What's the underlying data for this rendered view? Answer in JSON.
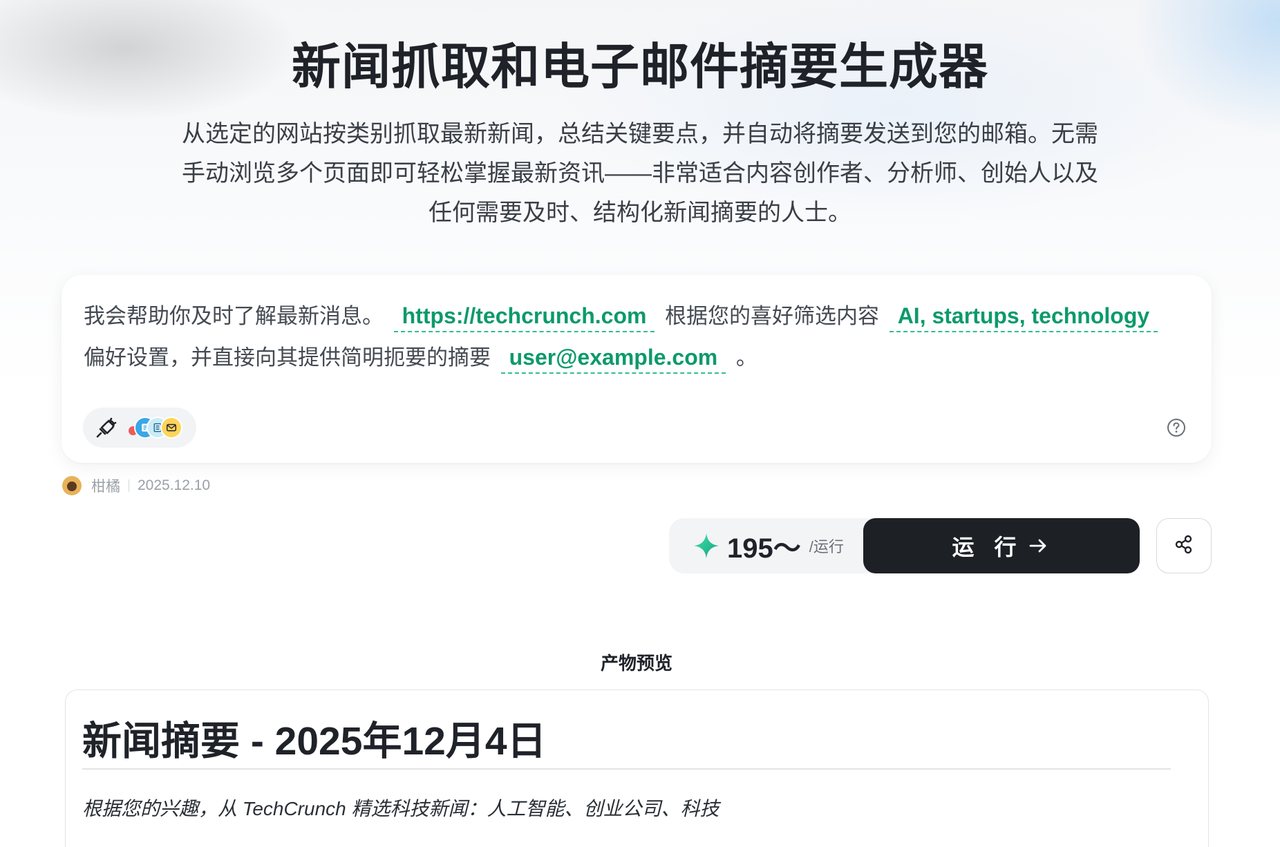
{
  "header": {
    "title": "新闻抓取和电子邮件摘要生成器",
    "description": "从选定的网站按类别抓取最新新闻，总结关键要点，并自动将摘要发送到您的邮箱。无需手动浏览多个页面即可轻松掌握最新资讯——非常适合内容创作者、分析师、创始人以及任何需要及时、结构化新闻摘要的人士。"
  },
  "prompt": {
    "text_1": "我会帮助你及时了解最新消息。",
    "var_website": "https://techcrunch.com",
    "text_2": "根据您的喜好筛选内容",
    "var_topics": "AI, startups, technology",
    "text_3": "偏好设置，并直接向其提供简明扼要的摘要",
    "var_email": "user@example.com",
    "text_4": "。"
  },
  "author": {
    "name": "柑橘",
    "date": "2025.12.10"
  },
  "run_bar": {
    "cost": "195～",
    "cost_unit": "/运行",
    "run_label": "运 行"
  },
  "preview": {
    "heading": "产物预览",
    "doc_title": "新闻摘要 - 2025年12月4日",
    "doc_subtitle": "根据您的兴趣，从 TechCrunch 精选科技新闻：人工智能、创业公司、科技"
  },
  "colors": {
    "accent_green": "#0c9a6b",
    "run_button": "#1d2025"
  },
  "icons": [
    "plug-icon",
    "tool-icons",
    "help-icon",
    "sparkle-icon",
    "arrow-right-icon",
    "share-icon"
  ]
}
